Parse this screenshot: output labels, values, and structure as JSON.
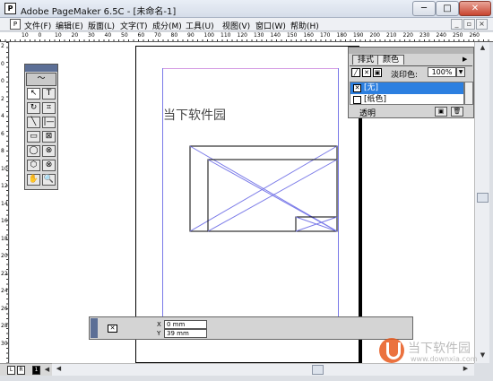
{
  "window": {
    "title": "Adobe PageMaker 6.5C - [未命名-1]",
    "app_icon": "P",
    "controls": {
      "minimize": "─",
      "maximize": "□",
      "close": "✕"
    }
  },
  "menu": {
    "items": [
      "文件(F)",
      "编辑(E)",
      "版面(L)",
      "文字(T)",
      "成分(M)",
      "工具(U)",
      "视图(V)",
      "窗口(W)",
      "帮助(H)"
    ],
    "mdi_controls": [
      "_",
      "▫",
      "×"
    ]
  },
  "rulers": {
    "horizontal_ticks": [
      "10",
      "0",
      "10",
      "20",
      "30",
      "40",
      "50",
      "60",
      "70",
      "80",
      "90",
      "100",
      "110",
      "120",
      "130",
      "140",
      "150",
      "160",
      "170",
      "180",
      "190",
      "200",
      "210",
      "220",
      "230",
      "240",
      "250",
      "260"
    ],
    "vertical_ticks": [
      "2",
      "0",
      "0",
      "2",
      "4",
      "6",
      "8",
      "10",
      "12",
      "14",
      "16",
      "18",
      "20",
      "22",
      "24",
      "26",
      "28",
      "30"
    ]
  },
  "canvas": {
    "text": "当下软件园"
  },
  "toolbox": {
    "tools": [
      {
        "name": "pointer-tool",
        "glyph": "↖"
      },
      {
        "name": "text-tool",
        "glyph": "T"
      },
      {
        "name": "rotate-tool",
        "glyph": "↻"
      },
      {
        "name": "crop-tool",
        "glyph": "⌗"
      },
      {
        "name": "line-tool",
        "glyph": "╲"
      },
      {
        "name": "constrained-line-tool",
        "glyph": "|—"
      },
      {
        "name": "rectangle-tool",
        "glyph": "▭"
      },
      {
        "name": "rectangle-frame-tool",
        "glyph": "⊠"
      },
      {
        "name": "ellipse-tool",
        "glyph": "◯"
      },
      {
        "name": "ellipse-frame-tool",
        "glyph": "⊗"
      },
      {
        "name": "polygon-tool",
        "glyph": "⬡"
      },
      {
        "name": "polygon-frame-tool",
        "glyph": "⊗"
      },
      {
        "name": "hand-tool",
        "glyph": "✋"
      },
      {
        "name": "zoom-tool",
        "glyph": "🔍"
      }
    ]
  },
  "color_palette": {
    "tabs": [
      "排式",
      "颜色"
    ],
    "active_tab": "颜色",
    "tint_label": "淡印色:",
    "tint_value": "100%",
    "swatches": [
      {
        "label": "[无]",
        "selected": true
      },
      {
        "label": "[纸色]",
        "selected": false
      }
    ],
    "transparent_label": "透明",
    "accent": "#2c7fe0"
  },
  "control_palette": {
    "x_label": "X",
    "x_value": "0 mm",
    "y_label": "Y",
    "y_value": "39 mm"
  },
  "page_nav": {
    "left_master": "L",
    "right_master": "R",
    "current_page": "1"
  },
  "watermark": {
    "text": "当下软件园",
    "url": "www.downxia.com"
  }
}
